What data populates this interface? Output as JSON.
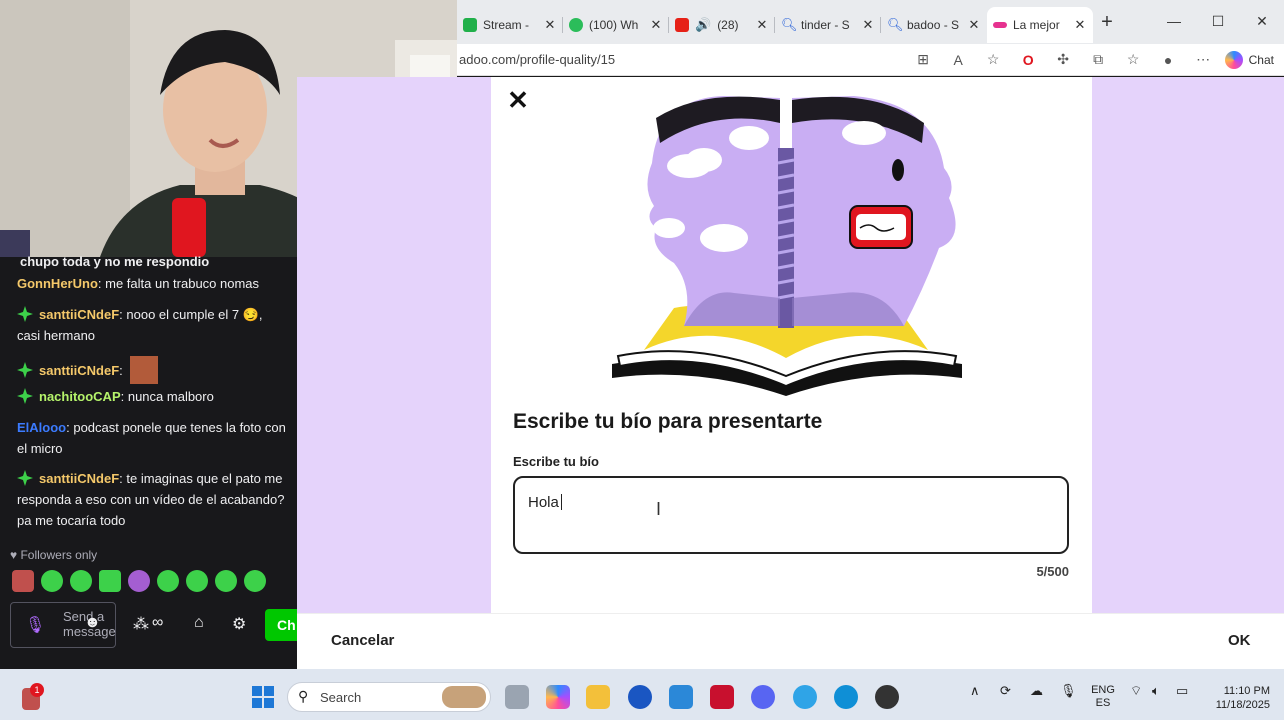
{
  "browser": {
    "tabs": [
      {
        "title": "Stream -",
        "color": "#21b04a"
      },
      {
        "title": "(100) Wh",
        "color": "#2bbd5a"
      },
      {
        "title": "(28)",
        "color": "#e62117"
      },
      {
        "title": "tinder - S",
        "color": "#2962d9"
      },
      {
        "title": "badoo - S",
        "color": "#2962d9"
      },
      {
        "title": "La mejor",
        "color": "#e6328f"
      }
    ],
    "active_tab_index": 5,
    "url": "adoo.com/profile-quality/15",
    "chat_label": "Chat"
  },
  "modal": {
    "title": "Escribe tu bío para presentarte",
    "field_label": "Escribe tu bío",
    "field_value": "Hola",
    "counter": "5/500",
    "cancel_label": "Cancelar",
    "ok_label": "OK"
  },
  "stream_chat": {
    "messages": [
      {
        "user": "",
        "text": "chupo toda y no me respondio",
        "user_color": "#efeff1",
        "badge": false
      },
      {
        "user": "GonnHerUno",
        "text": ": me falta un trabuco nomas",
        "user_color": "#f4c86a",
        "badge": false
      },
      {
        "user": "santtiiCNdeF",
        "text": ": nooo el cumple el 7 😏, casi hermano",
        "user_color": "#f4c86a",
        "badge": true
      },
      {
        "user": "santtiiCNdeF",
        "text": ":",
        "user_color": "#f4c86a",
        "badge": true
      },
      {
        "user": "nachitooCAP",
        "text": ": nunca malboro",
        "user_color": "#b5f36b",
        "badge": true
      },
      {
        "user": "ElAlooo",
        "text": ": podcast ponele que tenes la foto con el micro",
        "user_color": "#3b7bff",
        "badge": false
      },
      {
        "user": "santtiiCNdeF",
        "text": ": te imaginas que el pato me responda a eso con un vídeo de el acabando? pa me tocaría todo",
        "user_color": "#f4c86a",
        "badge": true
      }
    ],
    "followers_only": "Followers only",
    "input_placeholder": "Send a message",
    "send_label": "Ch"
  },
  "taskbar": {
    "search_placeholder": "Search",
    "language": "ENG",
    "language_sub": "ES",
    "time": "11:10 PM",
    "date": "11/18/2025",
    "notification_count": "1"
  }
}
